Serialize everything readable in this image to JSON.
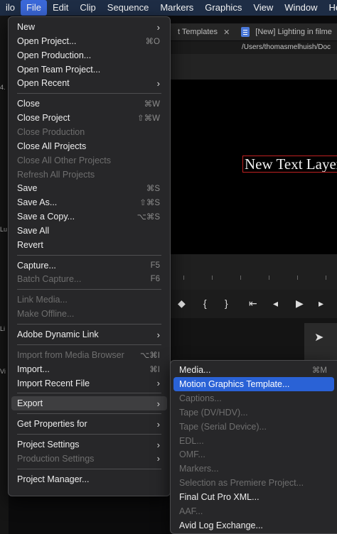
{
  "menubar": {
    "items": [
      {
        "label": "ilo",
        "active": false
      },
      {
        "label": "File",
        "active": true
      },
      {
        "label": "Edit",
        "active": false
      },
      {
        "label": "Clip",
        "active": false
      },
      {
        "label": "Sequence",
        "active": false
      },
      {
        "label": "Markers",
        "active": false
      },
      {
        "label": "Graphics",
        "active": false
      },
      {
        "label": "View",
        "active": false
      },
      {
        "label": "Window",
        "active": false
      },
      {
        "label": "Help",
        "active": false
      }
    ]
  },
  "tabs": {
    "tab1": "t Templates",
    "tab1_close": "✕",
    "tab2": "[New] Lighting in filme",
    "path": "/Users/thomasmelhuish/Doc"
  },
  "monitor": {
    "text_layer": "New Text Layer"
  },
  "left_fragments": [
    "4.",
    "Lu",
    "Li",
    "Vi"
  ],
  "file_menu": {
    "items": [
      {
        "label": "New",
        "shortcut": "",
        "submenu": true,
        "disabled": false
      },
      {
        "label": "Open Project...",
        "shortcut": "⌘O",
        "submenu": false,
        "disabled": false
      },
      {
        "label": "Open Production...",
        "shortcut": "",
        "submenu": false,
        "disabled": false
      },
      {
        "label": "Open Team Project...",
        "shortcut": "",
        "submenu": false,
        "disabled": false
      },
      {
        "label": "Open Recent",
        "shortcut": "",
        "submenu": true,
        "disabled": false
      },
      {
        "sep": true
      },
      {
        "label": "Close",
        "shortcut": "⌘W",
        "submenu": false,
        "disabled": false
      },
      {
        "label": "Close Project",
        "shortcut": "⇧⌘W",
        "submenu": false,
        "disabled": false
      },
      {
        "label": "Close Production",
        "shortcut": "",
        "submenu": false,
        "disabled": true
      },
      {
        "label": "Close All Projects",
        "shortcut": "",
        "submenu": false,
        "disabled": false
      },
      {
        "label": "Close All Other Projects",
        "shortcut": "",
        "submenu": false,
        "disabled": true
      },
      {
        "label": "Refresh All Projects",
        "shortcut": "",
        "submenu": false,
        "disabled": true
      },
      {
        "label": "Save",
        "shortcut": "⌘S",
        "submenu": false,
        "disabled": false
      },
      {
        "label": "Save As...",
        "shortcut": "⇧⌘S",
        "submenu": false,
        "disabled": false
      },
      {
        "label": "Save a Copy...",
        "shortcut": "⌥⌘S",
        "submenu": false,
        "disabled": false
      },
      {
        "label": "Save All",
        "shortcut": "",
        "submenu": false,
        "disabled": false
      },
      {
        "label": "Revert",
        "shortcut": "",
        "submenu": false,
        "disabled": false
      },
      {
        "sep": true
      },
      {
        "label": "Capture...",
        "shortcut": "F5",
        "submenu": false,
        "disabled": false
      },
      {
        "label": "Batch Capture...",
        "shortcut": "F6",
        "submenu": false,
        "disabled": true
      },
      {
        "sep": true
      },
      {
        "label": "Link Media...",
        "shortcut": "",
        "submenu": false,
        "disabled": true
      },
      {
        "label": "Make Offline...",
        "shortcut": "",
        "submenu": false,
        "disabled": true
      },
      {
        "sep": true
      },
      {
        "label": "Adobe Dynamic Link",
        "shortcut": "",
        "submenu": true,
        "disabled": false
      },
      {
        "sep": true
      },
      {
        "label": "Import from Media Browser",
        "shortcut": "⌥⌘I",
        "submenu": false,
        "disabled": true
      },
      {
        "label": "Import...",
        "shortcut": "⌘I",
        "submenu": false,
        "disabled": false
      },
      {
        "label": "Import Recent File",
        "shortcut": "",
        "submenu": true,
        "disabled": false
      },
      {
        "sep": true
      },
      {
        "label": "Export",
        "shortcut": "",
        "submenu": true,
        "disabled": false,
        "highlighted": true
      },
      {
        "sep": true
      },
      {
        "label": "Get Properties for",
        "shortcut": "",
        "submenu": true,
        "disabled": false
      },
      {
        "sep": true
      },
      {
        "label": "Project Settings",
        "shortcut": "",
        "submenu": true,
        "disabled": false
      },
      {
        "label": "Production Settings",
        "shortcut": "",
        "submenu": true,
        "disabled": true
      },
      {
        "sep": true
      },
      {
        "label": "Project Manager...",
        "shortcut": "",
        "submenu": false,
        "disabled": false
      }
    ]
  },
  "export_submenu": {
    "items": [
      {
        "label": "Media...",
        "shortcut": "⌘M",
        "disabled": false
      },
      {
        "label": "Motion Graphics Template...",
        "shortcut": "",
        "disabled": false,
        "selected": true
      },
      {
        "label": "Captions...",
        "shortcut": "",
        "disabled": true
      },
      {
        "label": "Tape (DV/HDV)...",
        "shortcut": "",
        "disabled": true
      },
      {
        "label": "Tape (Serial Device)...",
        "shortcut": "",
        "disabled": true
      },
      {
        "label": "EDL...",
        "shortcut": "",
        "disabled": true
      },
      {
        "label": "OMF...",
        "shortcut": "",
        "disabled": true
      },
      {
        "label": "Markers...",
        "shortcut": "",
        "disabled": true
      },
      {
        "label": "Selection as Premiere Project...",
        "shortcut": "",
        "disabled": true
      },
      {
        "label": "Final Cut Pro XML...",
        "shortcut": "",
        "disabled": false
      },
      {
        "label": "AAF...",
        "shortcut": "",
        "disabled": true
      },
      {
        "label": "Avid Log Exchange...",
        "shortcut": "",
        "disabled": false
      }
    ]
  },
  "colors": {
    "menubar_bg": "#1e2d45",
    "menubar_active": "#3b68d8",
    "selection_blue": "#2a62d6",
    "menu_bg": "#28282a",
    "text_layer_outline": "#c02020"
  }
}
